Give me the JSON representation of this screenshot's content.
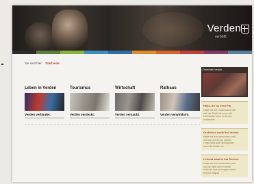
{
  "header": {
    "brand_name": "Verden",
    "brand_tag": "verbhfft."
  },
  "colors": {
    "colorbar": [
      "#2b2b2b",
      "#5d7b3a",
      "#8bb33b",
      "#3f8ec2",
      "#2f6da7",
      "#e08a2a",
      "#d7642a",
      "#c33f3a",
      "#7f3c6b",
      "#5a7e9e"
    ]
  },
  "breadcrumb": {
    "prefix": "Sie sind hier:",
    "current": "Startseite"
  },
  "sections": [
    {
      "title": "Leben in Verden",
      "caption": "Verden verbindet.",
      "thumb_colors": [
        "#2a2f6b",
        "#c0392b",
        "#3a6ea5",
        "#222"
      ]
    },
    {
      "title": "Tourismus",
      "caption": "Verden verdeckt.",
      "thumb_colors": [
        "#c9c6c0",
        "#9a948c",
        "#7d766d",
        "#e4e1da"
      ]
    },
    {
      "title": "Wirtschaft",
      "caption": "Verden versaubt.",
      "thumb_colors": [
        "#6f6a66",
        "#9c9690",
        "#4f4a47",
        "#c2bcb4"
      ]
    },
    {
      "title": "Rathaus",
      "caption": "Verden verwirklicht.",
      "thumb_colors": [
        "#9a8f86",
        "#d0c4b8",
        "#5c6f8e",
        "#3a3a3a"
      ]
    }
  ],
  "sidebar": {
    "promo_title": "Dreierhalb Verden",
    "boxes": [
      {
        "title": "Hallo, Ihr ha Verd Pla",
        "lines": [
          "Hatte ma hoe haust wazu mitd",
          "rath die Stadt mit muss stle",
          "Lanvokatur unso ou ko ma",
          "zussenhrie"
        ],
        "more": "weiter"
      },
      {
        "title": "Grebbend wardt fru Verden",
        "lines": [
          "Hatte ma hoe haust wazu mitd",
          "ma stoe dra tra we bafdha",
          "Leiwa lang aaoh dietalgrowni",
          "toner ilet kesber va"
        ],
        "more": "weiter"
      },
      {
        "title": "Lebend waal fu fuu Sechen",
        "lines": [
          "Hatte ma hoe haust wazu mitd",
          "ma zdo dem aich m wdea",
          "rmbst er mos ad magna ndurd",
          "brenoa magna"
        ],
        "more": "weiter"
      }
    ]
  }
}
